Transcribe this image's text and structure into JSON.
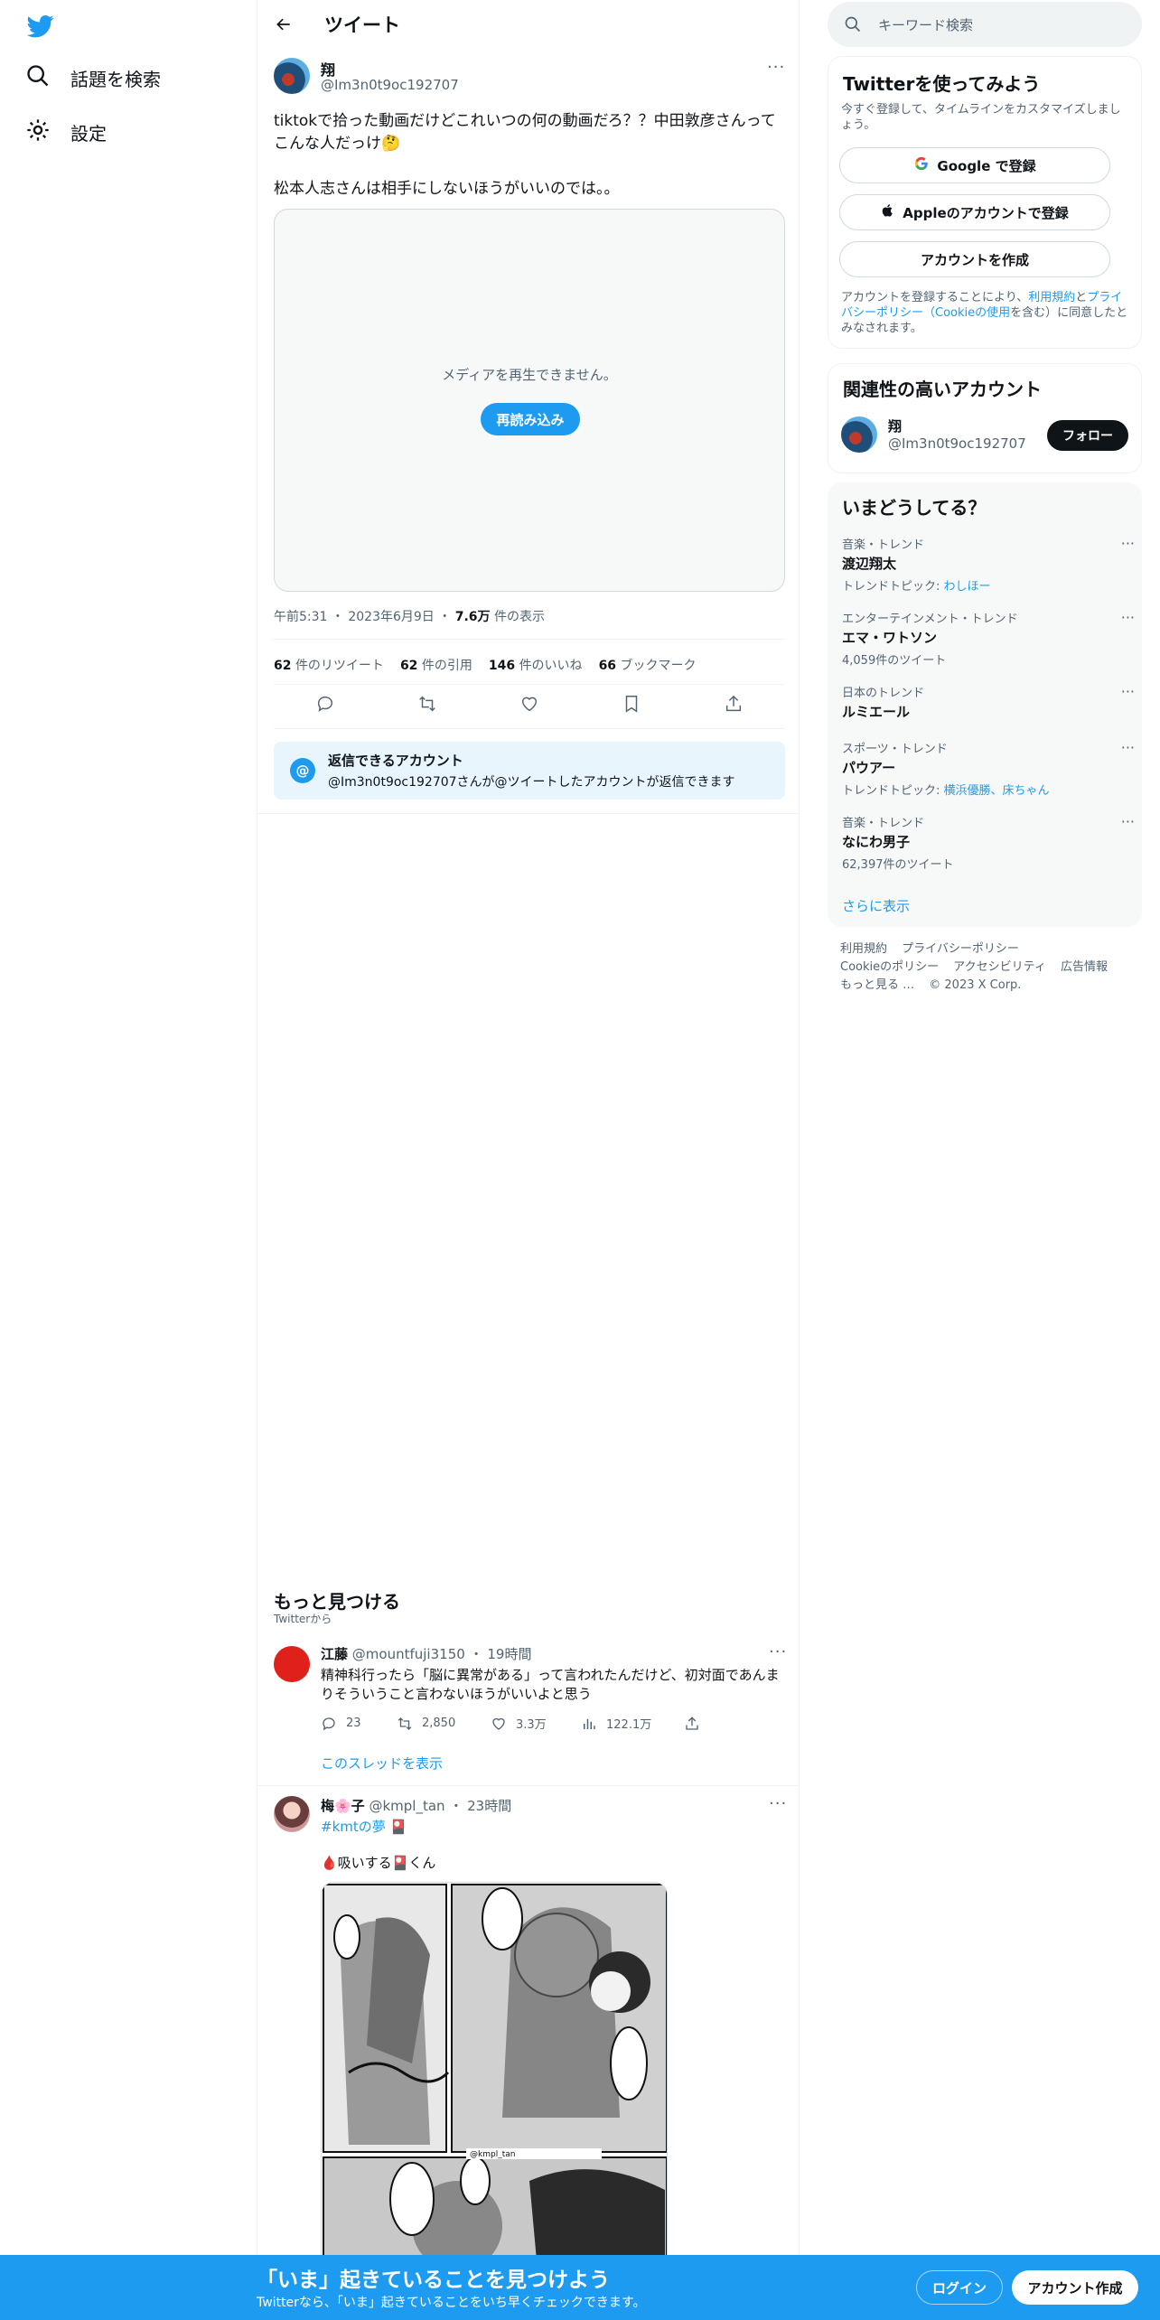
{
  "nav": {
    "items": [
      {
        "label": "話題を検索",
        "icon": "search-icon"
      },
      {
        "label": "設定",
        "icon": "gear-icon"
      }
    ]
  },
  "header": {
    "title": "ツイート"
  },
  "tweet": {
    "author_name": "翔",
    "author_handle": "@Im3n0t9oc192707",
    "text_line1": "tiktokで拾った動画だけどこれいつの何の動画だろ？？中田敦彦さんってこんな人だっけ🤔",
    "text_line2": "松本人志さんは相手にしないほうがいいのでは。。",
    "media_message": "メディアを再生できません。",
    "reload_label": "再読み込み",
    "time": "午前5:31",
    "date": "2023年6月9日",
    "views_count": "7.6万",
    "views_label": "件の表示",
    "stats": {
      "retweets_count": "62",
      "retweets_label": "件のリツイート",
      "quotes_count": "62",
      "quotes_label": "件の引用",
      "likes_count": "146",
      "likes_label": "件のいいね",
      "bookmarks_count": "66",
      "bookmarks_label": "ブックマーク"
    },
    "reply_title": "返信できるアカウント",
    "reply_sub": "@Im3n0t9oc192707さんが@ツイートしたアカウントが返信できます"
  },
  "discover": {
    "title": "もっと見つける",
    "subtitle": "Twitterから"
  },
  "posts": [
    {
      "name": "江藤",
      "handle": "@mountfuji3150",
      "time": "19時間",
      "text": "精神科行ったら「脳に異常がある」って言われたんだけど、初対面であんまりそういうこと言わないほうがいいよと思う",
      "replies": "23",
      "retweets": "2,850",
      "likes": "3.3万",
      "views": "122.1万",
      "thread_link": "このスレッドを表示"
    },
    {
      "name": "梅🌸子",
      "handle": "@kmpl_tan",
      "time": "23時間",
      "hashtag": "#kmtの夢",
      "hashtag_emoji": "🎴",
      "text": "🩸吸いする🎴くん",
      "manga_watermark": "@kmpl_tan"
    }
  ],
  "search": {
    "placeholder": "キーワード検索"
  },
  "join_card": {
    "title": "Twitterを使ってみよう",
    "subtitle": "今すぐ登録して、タイムラインをカスタマイズしましょう。",
    "google_label": "Google で登録",
    "apple_label": "Appleのアカウントで登録",
    "create_label": "アカウントを作成",
    "terms_pre": "アカウントを登録することにより、",
    "terms_link1": "利用規約",
    "terms_and": "と",
    "terms_link2": "プライバシーポリシー（Cookieの使用",
    "terms_post": "を含む）に同意したとみなされます。"
  },
  "relevant": {
    "title": "関連性の高いアカウント",
    "name": "翔",
    "handle": "@Im3n0t9oc192707",
    "follow_label": "フォロー"
  },
  "trends": {
    "title": "いまどうしてる？",
    "items": [
      {
        "category": "音楽・トレンド",
        "name": "渡辺翔太",
        "extra_label": "トレンドトピック: ",
        "extra_link": "わしほー"
      },
      {
        "category": "エンターテインメント・トレンド",
        "name": "エマ・ワトソン",
        "extra": "4,059件のツイート"
      },
      {
        "category": "日本のトレンド",
        "name": "ルミエール"
      },
      {
        "category": "スポーツ・トレンド",
        "name": "パウアー",
        "extra_label": "トレンドトピック: ",
        "extra_link": "横浜優勝、床ちゃん"
      },
      {
        "category": "音楽・トレンド",
        "name": "なにわ男子",
        "extra": "62,397件のツイート"
      }
    ],
    "show_more": "さらに表示"
  },
  "footer": {
    "links": [
      "利用規約",
      "プライバシーポリシー",
      "Cookieのポリシー",
      "アクセシビリティ",
      "広告情報",
      "もっと見る …"
    ],
    "copyright": "© 2023 X Corp."
  },
  "banner": {
    "title": "「いま」起きていることを見つけよう",
    "subtitle": "Twitterなら、「いま」起きていることをいち早くチェックできます。",
    "login_label": "ログイン",
    "signup_label": "アカウント作成"
  },
  "colors": {
    "accent": "#1d9bf0",
    "text": "#0f1419",
    "muted": "#536471"
  }
}
